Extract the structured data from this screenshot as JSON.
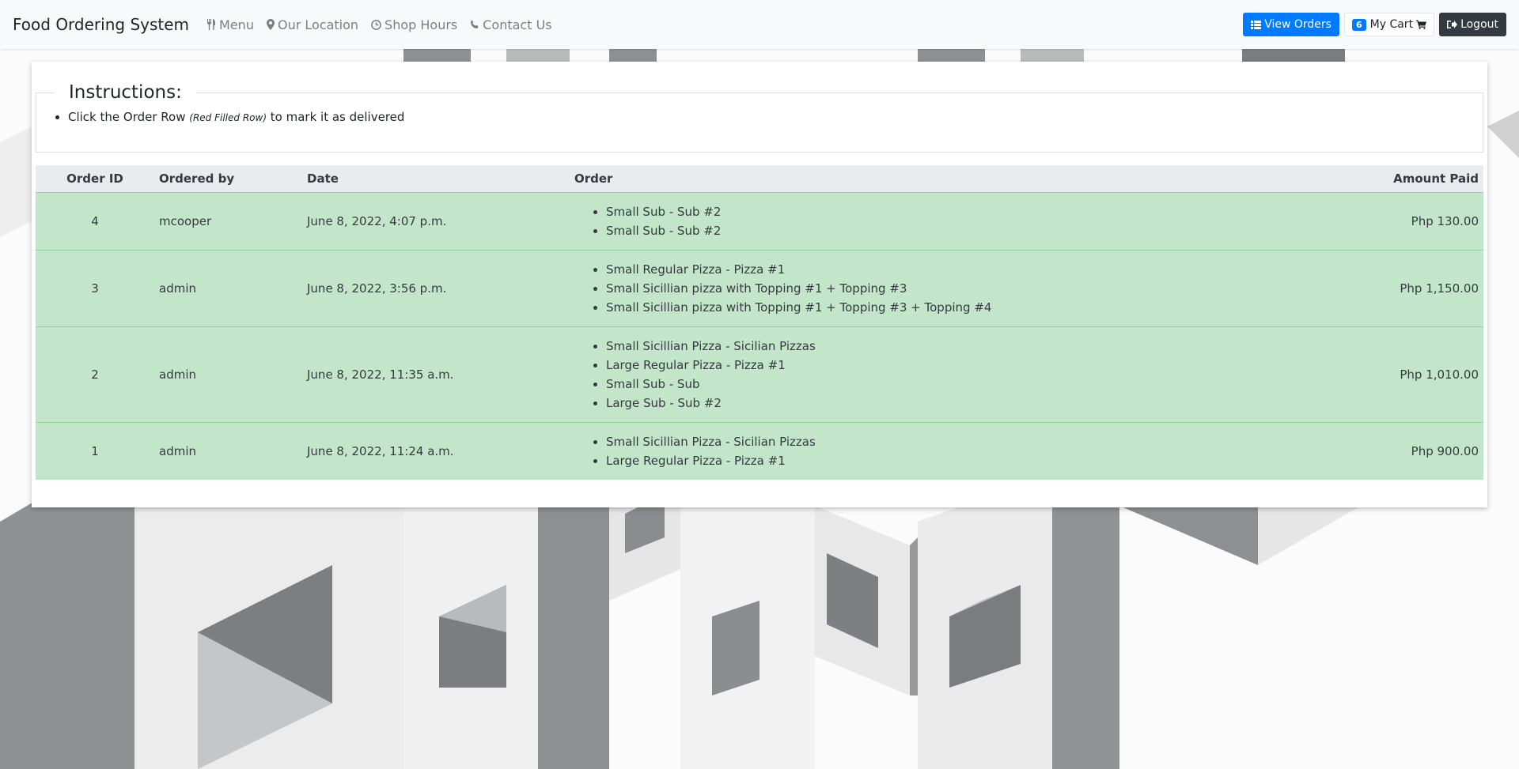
{
  "navbar": {
    "brand": "Food Ordering System",
    "links": [
      {
        "label": "Menu",
        "icon": "cutlery-icon"
      },
      {
        "label": "Our Location",
        "icon": "map-marker-icon"
      },
      {
        "label": "Shop Hours",
        "icon": "clock-icon"
      },
      {
        "label": "Contact Us",
        "icon": "phone-icon"
      }
    ],
    "view_orders_label": "View Orders",
    "cart_count": "6",
    "cart_label": "My Cart",
    "logout_label": "Logout"
  },
  "instructions": {
    "title": "Instructions:",
    "item_prefix": "Click the Order Row",
    "item_hint": "(Red Filled Row)",
    "item_suffix": "to mark it as delivered"
  },
  "orders": {
    "headers": [
      "Order ID",
      "Ordered by",
      "Date",
      "Order",
      "Amount Paid"
    ],
    "rows": [
      {
        "id": "4",
        "by": "mcooper",
        "date": "June 8, 2022, 4:07 p.m.",
        "items": [
          "Small Sub - Sub #2",
          "Small Sub - Sub #2"
        ],
        "amount": "Php 130.00"
      },
      {
        "id": "3",
        "by": "admin",
        "date": "June 8, 2022, 3:56 p.m.",
        "items": [
          "Small Regular Pizza - Pizza #1",
          "Small Sicillian pizza with Topping #1 + Topping #3",
          "Small Sicillian pizza with Topping #1 + Topping #3 + Topping #4"
        ],
        "amount": "Php 1,150.00"
      },
      {
        "id": "2",
        "by": "admin",
        "date": "June 8, 2022, 11:35 a.m.",
        "items": [
          "Small Sicillian Pizza - Sicilian Pizzas",
          "Large Regular Pizza - Pizza #1",
          "Small Sub - Sub",
          "Large Sub - Sub #2"
        ],
        "amount": "Php 1,010.00"
      },
      {
        "id": "1",
        "by": "admin",
        "date": "June 8, 2022, 11:24 a.m.",
        "items": [
          "Small Sicillian Pizza - Sicilian Pizzas",
          "Large Regular Pizza - Pizza #1"
        ],
        "amount": "Php 900.00"
      }
    ]
  },
  "colors": {
    "primary": "#007bff",
    "dark": "#343a40",
    "delivered_row": "#c3e6cb",
    "table_header": "#e9ecef"
  }
}
